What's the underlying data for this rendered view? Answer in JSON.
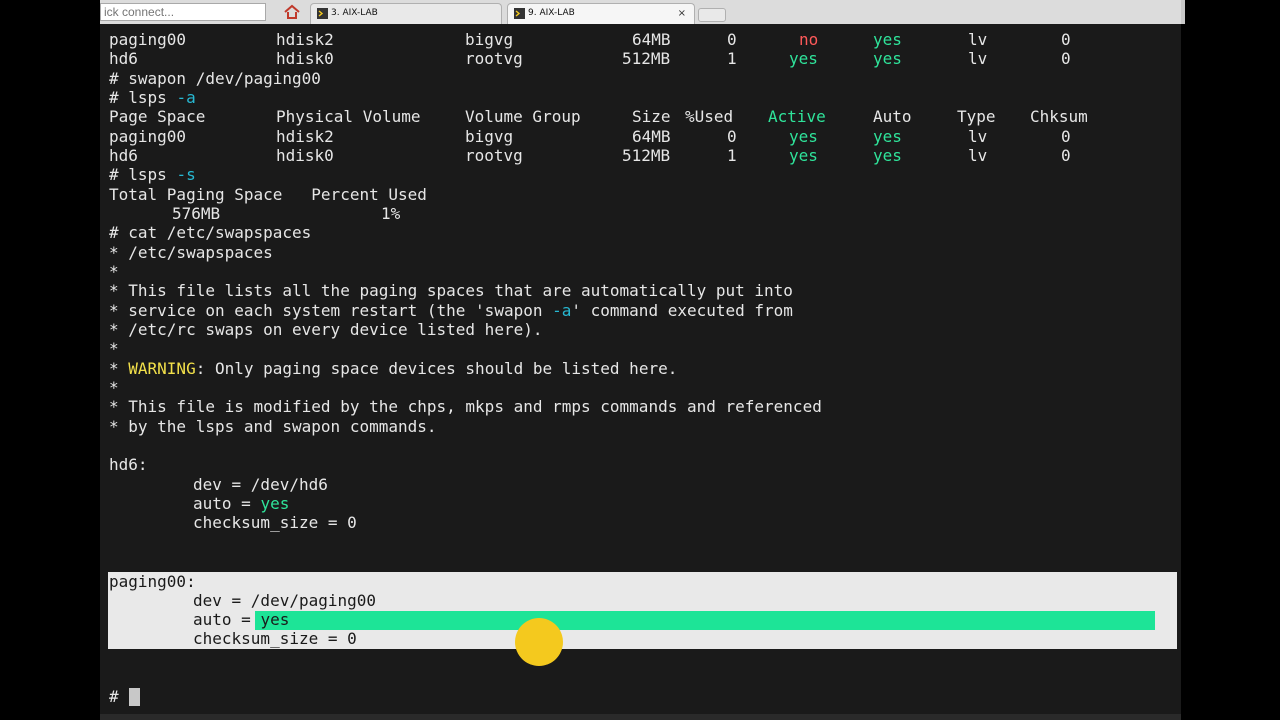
{
  "toolbar": {
    "quick_connect_placeholder": "ick connect...",
    "home_icon": "home-icon"
  },
  "tabs": [
    {
      "label": "3. AIX-LAB",
      "icon": "terminal-icon",
      "active": false
    },
    {
      "label": "9. AIX-LAB",
      "icon": "terminal-icon",
      "active": true,
      "close": "×"
    }
  ],
  "terminal": {
    "top_rows": [
      {
        "ps": "paging00",
        "pv": "hdisk2",
        "vg": "bigvg",
        "size": "64MB",
        "used": "0",
        "active": "no",
        "auto": "yes",
        "type": "lv",
        "chksum": "0"
      },
      {
        "ps": "hd6",
        "pv": "hdisk0",
        "vg": "rootvg",
        "size": "512MB",
        "used": "1",
        "active": "yes",
        "auto": "yes",
        "type": "lv",
        "chksum": "0"
      }
    ],
    "cmd_swapon": "# swapon /dev/paging00",
    "cmd_lsps_a": {
      "prompt": "# lsps ",
      "flag": "-a"
    },
    "headers": {
      "ps": "Page Space",
      "pv": "Physical Volume",
      "vg": "Volume Group",
      "size": "Size",
      "used": "%Used",
      "active": "Active",
      "auto": "Auto",
      "type": "Type",
      "chksum": "Chksum"
    },
    "rows": [
      {
        "ps": "paging00",
        "pv": "hdisk2",
        "vg": "bigvg",
        "size": "64MB",
        "used": "0",
        "active": "yes",
        "auto": "yes",
        "type": "lv",
        "chksum": "0"
      },
      {
        "ps": "hd6",
        "pv": "hdisk0",
        "vg": "rootvg",
        "size": "512MB",
        "used": "1",
        "active": "yes",
        "auto": "yes",
        "type": "lv",
        "chksum": "0"
      }
    ],
    "cmd_lsps_s": {
      "prompt": "# lsps ",
      "flag": "-s"
    },
    "summary_header": "Total Paging Space   Percent Used",
    "summary_total": "576MB",
    "summary_percent": "1%",
    "cmd_cat": "# cat /etc/swapspaces",
    "file_lines": [
      "* /etc/swapspaces",
      "*",
      "* This file lists all the paging spaces that are automatically put into",
      "service on each system restart (the 'swapon -a' command executed from",
      "* /etc/rc swaps on every device listed here).",
      "*",
      "WARNING_LINE",
      "*",
      "* This file is modified by the chps, mkps and rmps commands and referenced",
      "* by the lsps and swapon commands."
    ],
    "comment_service_prefix": "* service on each system restart (the 'swapon ",
    "comment_service_flag": "-a",
    "comment_service_suffix": "' command executed from",
    "warning_prefix": "* ",
    "warning_word": "WARNING",
    "warning_rest": ": Only paging space devices should be listed here.",
    "stanza_hd6": {
      "name": "hd6:",
      "dev": "dev = /dev/hd6",
      "auto_key": "auto = ",
      "auto_val": "yes",
      "checksum": "checksum_size = 0"
    },
    "stanza_paging00": {
      "name": "paging00:",
      "dev": "dev = /dev/paging00",
      "auto_key": "auto = ",
      "auto_val": "yes",
      "checksum": "checksum_size = 0"
    },
    "prompt": "#"
  },
  "colors": {
    "green": "#2fe39a",
    "red": "#ff5a5a",
    "cyan": "#27b8d2",
    "yellow": "#f2e04a",
    "highlight": "#1de497",
    "cursor_dot": "#f4c91e"
  }
}
